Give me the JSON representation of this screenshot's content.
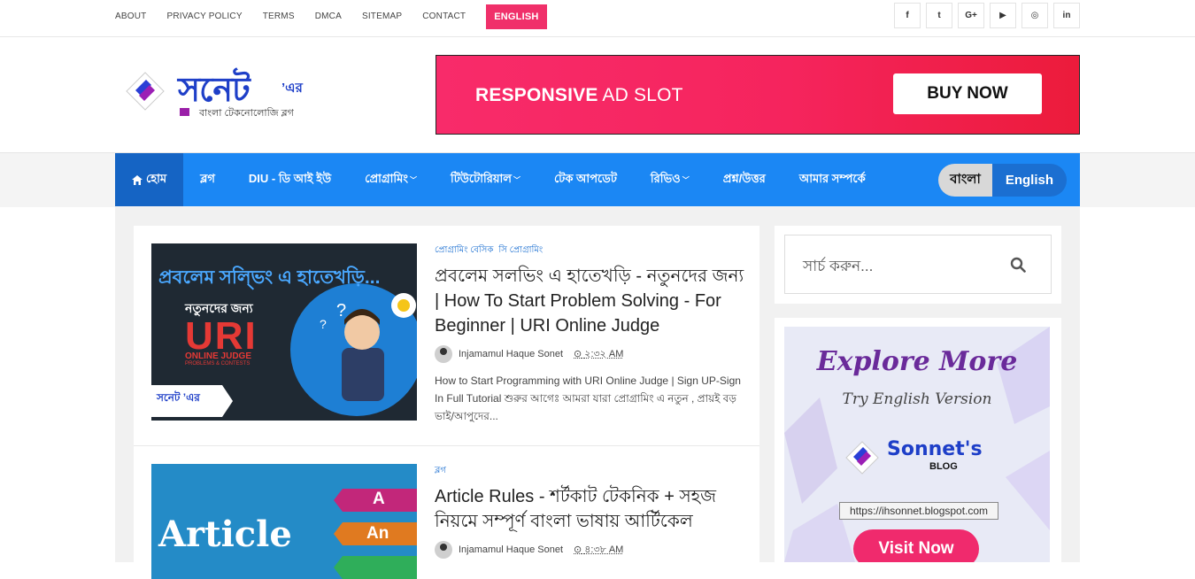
{
  "topnav": {
    "links": [
      "ABOUT",
      "PRIVACY POLICY",
      "TERMS",
      "DMCA",
      "SITEMAP",
      "CONTACT"
    ],
    "english_button": "ENGLISH"
  },
  "social": {
    "icons": [
      "facebook-icon",
      "twitter-icon",
      "google-plus-icon",
      "youtube-icon",
      "github-icon",
      "linkedin-icon"
    ],
    "glyphs": [
      "f",
      "t",
      "G+",
      "▶",
      "◎",
      "in"
    ]
  },
  "logo": {
    "title": "সনেট",
    "suffix": "’এর",
    "subtitle": "বাংলা টেকনোলোজি ব্লগ"
  },
  "ad": {
    "text_bold": "RESPONSIVE",
    "text_normal": " AD SLOT",
    "button": "BUY NOW"
  },
  "nav": {
    "home": "হোম",
    "items": [
      {
        "label": "ব্লগ",
        "dropdown": false
      },
      {
        "label": "DIU - ডি আই ইউ",
        "dropdown": false
      },
      {
        "label": "প্রোগ্রামিং",
        "dropdown": true
      },
      {
        "label": "টিউটোরিয়াল",
        "dropdown": true
      },
      {
        "label": "টেক আপডেট",
        "dropdown": false
      },
      {
        "label": "রিভিও",
        "dropdown": true
      },
      {
        "label": "প্রশ্ন/উত্তর",
        "dropdown": false
      },
      {
        "label": "আমার সম্পর্কে",
        "dropdown": false
      }
    ],
    "lang_bn": "বাংলা",
    "lang_en": "English"
  },
  "posts": [
    {
      "categories": [
        "প্রোগ্রামিং বেসিক",
        "সি প্রোগ্রামিং"
      ],
      "title": "প্রবলেম সলভিং এ হাতেখড়ি - নতুনদের জন্য | How To Start Problem Solving - For Beginner | URI Online Judge",
      "author": "Injamamul Haque Sonet",
      "time": "২:৩২ AM",
      "excerpt": "How to Start Programming with URI Online Judge | Sign UP-Sign In Full Tutorial শুরুর আগেঃ আমরা যারা প্রোগ্রামিং এ নতুন , প্রায়ই বড় ভাই/আপুদের...",
      "thumb": {
        "headline": "প্রবলেম সল্ভিং এ হাতেখড়ি...",
        "sub": "নতুনদের জন্য",
        "big": "URI",
        "small1": "ONLINE JUDGE",
        "small2": "PROBLEMS & CONTESTS",
        "badge": "সনেট ’এর"
      }
    },
    {
      "categories": [
        "ব্লগ"
      ],
      "title": "Article Rules - শর্টকাট টেকনিক + সহজ নিয়মে সম্পূর্ণ বাংলা ভাষায় আর্টিকেল",
      "author": "Injamamul Haque Sonet",
      "time": "৪:৩৮ AM",
      "thumb": {
        "word": "Article",
        "tag_a": "A",
        "tag_an": "An"
      }
    }
  ],
  "search": {
    "placeholder": "সার্চ করুন..."
  },
  "promo": {
    "heading": "Explore More",
    "sub": "Try English Version",
    "name": "Sonnet's",
    "blog": "BLOG",
    "url": "https://ihsonnet.blogspot.com",
    "button": "Visit Now"
  },
  "colors": {
    "accent_pink": "#f0306a",
    "nav_blue": "#1b87f4",
    "nav_active": "#1564c4",
    "link_blue": "#1b6fd1"
  }
}
